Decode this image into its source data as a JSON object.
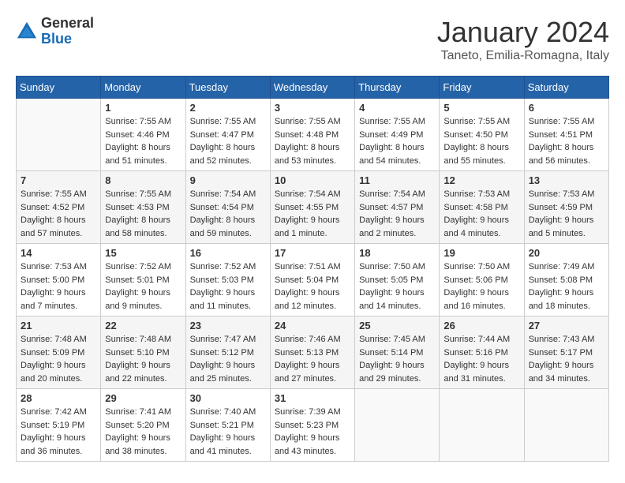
{
  "header": {
    "logo_general": "General",
    "logo_blue": "Blue",
    "month_title": "January 2024",
    "location": "Taneto, Emilia-Romagna, Italy"
  },
  "days_of_week": [
    "Sunday",
    "Monday",
    "Tuesday",
    "Wednesday",
    "Thursday",
    "Friday",
    "Saturday"
  ],
  "weeks": [
    [
      {
        "day": "",
        "info": ""
      },
      {
        "day": "1",
        "info": "Sunrise: 7:55 AM\nSunset: 4:46 PM\nDaylight: 8 hours\nand 51 minutes."
      },
      {
        "day": "2",
        "info": "Sunrise: 7:55 AM\nSunset: 4:47 PM\nDaylight: 8 hours\nand 52 minutes."
      },
      {
        "day": "3",
        "info": "Sunrise: 7:55 AM\nSunset: 4:48 PM\nDaylight: 8 hours\nand 53 minutes."
      },
      {
        "day": "4",
        "info": "Sunrise: 7:55 AM\nSunset: 4:49 PM\nDaylight: 8 hours\nand 54 minutes."
      },
      {
        "day": "5",
        "info": "Sunrise: 7:55 AM\nSunset: 4:50 PM\nDaylight: 8 hours\nand 55 minutes."
      },
      {
        "day": "6",
        "info": "Sunrise: 7:55 AM\nSunset: 4:51 PM\nDaylight: 8 hours\nand 56 minutes."
      }
    ],
    [
      {
        "day": "7",
        "info": "Sunrise: 7:55 AM\nSunset: 4:52 PM\nDaylight: 8 hours\nand 57 minutes."
      },
      {
        "day": "8",
        "info": "Sunrise: 7:55 AM\nSunset: 4:53 PM\nDaylight: 8 hours\nand 58 minutes."
      },
      {
        "day": "9",
        "info": "Sunrise: 7:54 AM\nSunset: 4:54 PM\nDaylight: 8 hours\nand 59 minutes."
      },
      {
        "day": "10",
        "info": "Sunrise: 7:54 AM\nSunset: 4:55 PM\nDaylight: 9 hours\nand 1 minute."
      },
      {
        "day": "11",
        "info": "Sunrise: 7:54 AM\nSunset: 4:57 PM\nDaylight: 9 hours\nand 2 minutes."
      },
      {
        "day": "12",
        "info": "Sunrise: 7:53 AM\nSunset: 4:58 PM\nDaylight: 9 hours\nand 4 minutes."
      },
      {
        "day": "13",
        "info": "Sunrise: 7:53 AM\nSunset: 4:59 PM\nDaylight: 9 hours\nand 5 minutes."
      }
    ],
    [
      {
        "day": "14",
        "info": "Sunrise: 7:53 AM\nSunset: 5:00 PM\nDaylight: 9 hours\nand 7 minutes."
      },
      {
        "day": "15",
        "info": "Sunrise: 7:52 AM\nSunset: 5:01 PM\nDaylight: 9 hours\nand 9 minutes."
      },
      {
        "day": "16",
        "info": "Sunrise: 7:52 AM\nSunset: 5:03 PM\nDaylight: 9 hours\nand 11 minutes."
      },
      {
        "day": "17",
        "info": "Sunrise: 7:51 AM\nSunset: 5:04 PM\nDaylight: 9 hours\nand 12 minutes."
      },
      {
        "day": "18",
        "info": "Sunrise: 7:50 AM\nSunset: 5:05 PM\nDaylight: 9 hours\nand 14 minutes."
      },
      {
        "day": "19",
        "info": "Sunrise: 7:50 AM\nSunset: 5:06 PM\nDaylight: 9 hours\nand 16 minutes."
      },
      {
        "day": "20",
        "info": "Sunrise: 7:49 AM\nSunset: 5:08 PM\nDaylight: 9 hours\nand 18 minutes."
      }
    ],
    [
      {
        "day": "21",
        "info": "Sunrise: 7:48 AM\nSunset: 5:09 PM\nDaylight: 9 hours\nand 20 minutes."
      },
      {
        "day": "22",
        "info": "Sunrise: 7:48 AM\nSunset: 5:10 PM\nDaylight: 9 hours\nand 22 minutes."
      },
      {
        "day": "23",
        "info": "Sunrise: 7:47 AM\nSunset: 5:12 PM\nDaylight: 9 hours\nand 25 minutes."
      },
      {
        "day": "24",
        "info": "Sunrise: 7:46 AM\nSunset: 5:13 PM\nDaylight: 9 hours\nand 27 minutes."
      },
      {
        "day": "25",
        "info": "Sunrise: 7:45 AM\nSunset: 5:14 PM\nDaylight: 9 hours\nand 29 minutes."
      },
      {
        "day": "26",
        "info": "Sunrise: 7:44 AM\nSunset: 5:16 PM\nDaylight: 9 hours\nand 31 minutes."
      },
      {
        "day": "27",
        "info": "Sunrise: 7:43 AM\nSunset: 5:17 PM\nDaylight: 9 hours\nand 34 minutes."
      }
    ],
    [
      {
        "day": "28",
        "info": "Sunrise: 7:42 AM\nSunset: 5:19 PM\nDaylight: 9 hours\nand 36 minutes."
      },
      {
        "day": "29",
        "info": "Sunrise: 7:41 AM\nSunset: 5:20 PM\nDaylight: 9 hours\nand 38 minutes."
      },
      {
        "day": "30",
        "info": "Sunrise: 7:40 AM\nSunset: 5:21 PM\nDaylight: 9 hours\nand 41 minutes."
      },
      {
        "day": "31",
        "info": "Sunrise: 7:39 AM\nSunset: 5:23 PM\nDaylight: 9 hours\nand 43 minutes."
      },
      {
        "day": "",
        "info": ""
      },
      {
        "day": "",
        "info": ""
      },
      {
        "day": "",
        "info": ""
      }
    ]
  ]
}
